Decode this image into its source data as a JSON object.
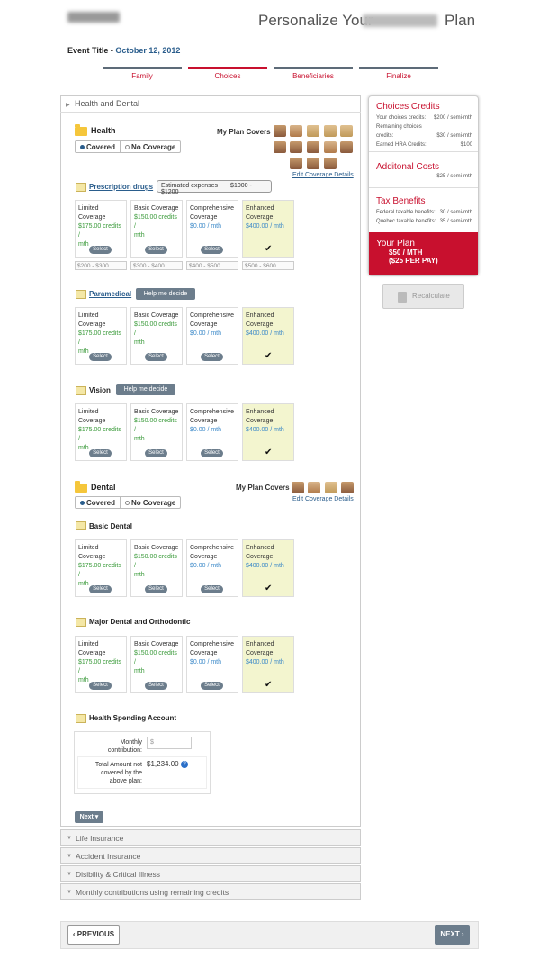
{
  "header": {
    "title_left": "Personalize Your",
    "title_right": "Plan",
    "event_label": "Event Title - ",
    "event_date": "October 12, 2012"
  },
  "steps": [
    {
      "label": "Family"
    },
    {
      "label": "Choices"
    },
    {
      "label": "Beneficiaries"
    },
    {
      "label": "Finalize"
    }
  ],
  "main": {
    "header": "Health and Dental"
  },
  "health": {
    "title": "Health",
    "covered": "Covered",
    "no_coverage": "No Coverage",
    "my_plan_covers": "My Plan Covers",
    "edit_link": "Edit Coverage Details",
    "prescription": {
      "title": "Prescription drugs",
      "expenses": "Estimated expenses",
      "expenses_range": "$1000 - $1200"
    },
    "paramedical": {
      "title": "Paramedical",
      "help": "Help me decide"
    },
    "vision": {
      "title": "Vision",
      "help": "Help me decide"
    }
  },
  "cards": [
    {
      "name1": "Limited",
      "name2": "Coverage",
      "p1": "$175.00 credits /",
      "p2": "mth"
    },
    {
      "name1": "Basic Coverage",
      "name2": "",
      "p1": "$150.00 credits /",
      "p2": "mth"
    },
    {
      "name1": "Comprehensive",
      "name2": "Coverage",
      "p1": "$0.00 / mth",
      "p2": ""
    },
    {
      "name1": "Enhanced",
      "name2": "Coverage",
      "p1": "$400.00 / mth",
      "p2": ""
    }
  ],
  "select_label": "Select",
  "ranges": [
    "$200 - $300",
    "$300 - $400",
    "$400 - $500",
    "$500 - $600"
  ],
  "dental": {
    "title": "Dental",
    "covered": "Covered",
    "no_coverage": "No Coverage",
    "my_plan_covers": "My Plan Covers",
    "edit_link": "Edit Coverage Details",
    "basic": "Basic Dental",
    "major": "Major Dental and Orthodontic"
  },
  "hsa": {
    "title": "Health Spending Account",
    "monthly1": "Monthly",
    "monthly2": "contribution:",
    "currency": "$",
    "total1": "Total Amount not",
    "total2": "covered by the",
    "total3": "above plan:",
    "total_value": "$1,234.00"
  },
  "next_small": "Next",
  "accordions": [
    "Life Insurance",
    "Accident Insurance",
    "Disibility & Critical Illness",
    "Monthly contributions using remaining credits"
  ],
  "sidebar": {
    "credits_title": "Choices Credits",
    "credits_rows": [
      [
        "Your choices credits:",
        "$200 / semi-mth"
      ],
      [
        "Remaining choices",
        ""
      ],
      [
        "credits:",
        "$30 / semi-mth"
      ],
      [
        "Earned HRA Credits:",
        "$100"
      ]
    ],
    "add_title": "Additonal Costs",
    "add_value": "$25 / semi-mth",
    "tax_title": "Tax Benefits",
    "tax_rows": [
      [
        "Federal taxable benefits:",
        "30 / semi-mth"
      ],
      [
        "Quebec taxable benefits:",
        "35 / semi-mth"
      ]
    ],
    "plan_title": "Your Plan",
    "plan_value": "$50 / MTH",
    "plan_sub": "($25 PER PAY)",
    "recalc": "Recalculate"
  },
  "footer": {
    "prev": "‹ PREVIOUS",
    "next": "NEXT ›"
  }
}
